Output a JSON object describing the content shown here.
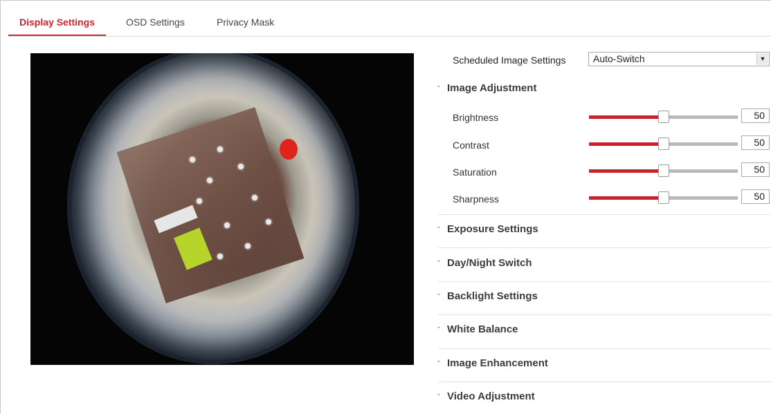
{
  "tabs": [
    {
      "label": "Display Settings",
      "active": true
    },
    {
      "label": "OSD Settings",
      "active": false
    },
    {
      "label": "Privacy Mask",
      "active": false
    }
  ],
  "scheduled": {
    "label": "Scheduled Image Settings",
    "value": "Auto-Switch"
  },
  "image_adjustment": {
    "title": "Image Adjustment",
    "expanded": true,
    "sliders": [
      {
        "label": "Brightness",
        "value": "50",
        "level": 0.5
      },
      {
        "label": "Contrast",
        "value": "50",
        "level": 0.5
      },
      {
        "label": "Saturation",
        "value": "50",
        "level": 0.5
      },
      {
        "label": "Sharpness",
        "value": "50",
        "level": 0.5
      }
    ]
  },
  "sections": [
    {
      "title": "Exposure Settings"
    },
    {
      "title": "Day/Night Switch"
    },
    {
      "title": "Backlight Settings"
    },
    {
      "title": "White Balance"
    },
    {
      "title": "Image Enhancement"
    },
    {
      "title": "Video Adjustment"
    }
  ],
  "icons": {
    "collapse": "chevron-up-icon",
    "expand": "chevron-down-icon",
    "dropdown": "dropdown-arrow-icon"
  },
  "colors": {
    "accent": "#d0232f",
    "slider_fill": "#c8232c",
    "slider_track": "#b9b9b9"
  }
}
